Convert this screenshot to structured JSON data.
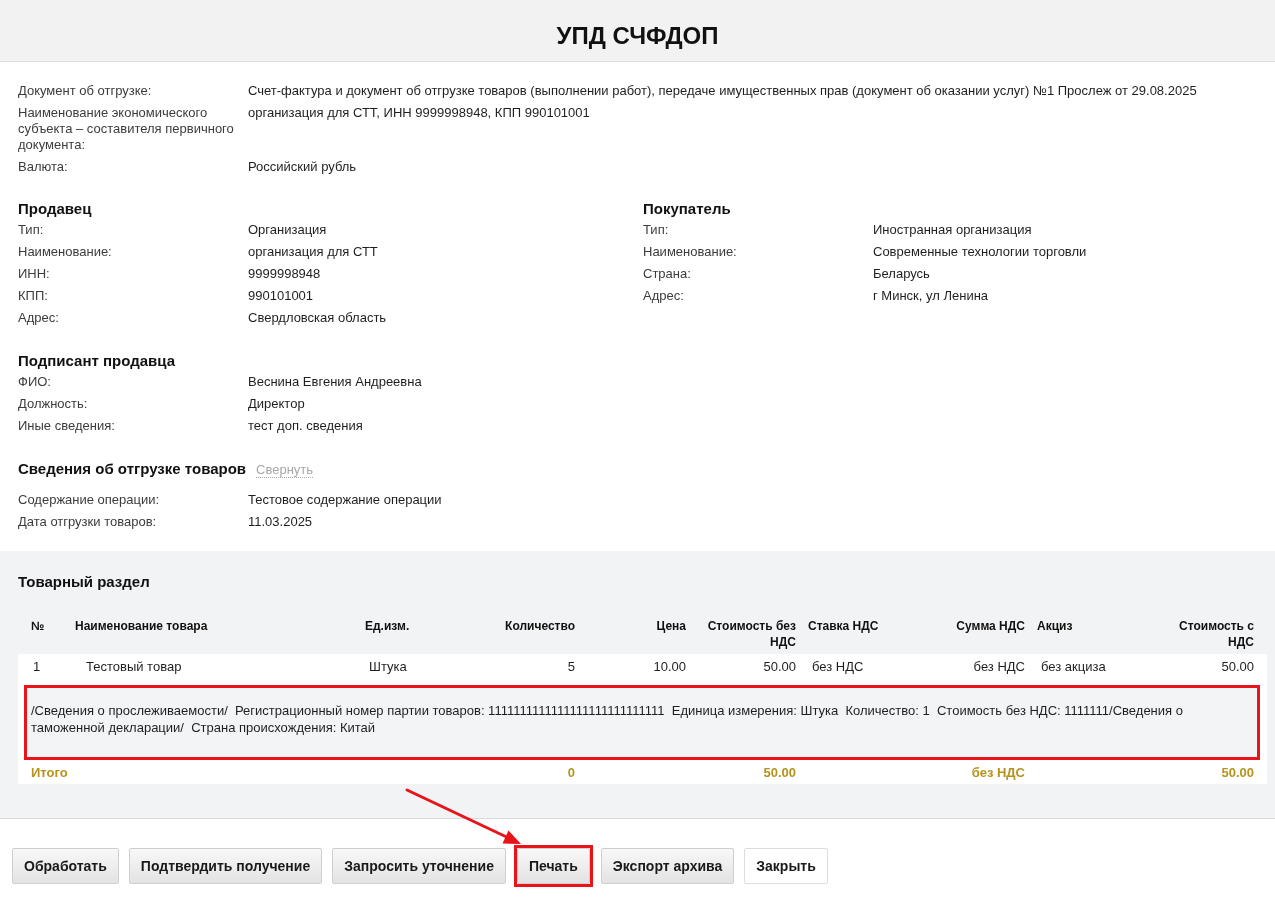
{
  "window": {
    "title": "УПД СЧФДОП"
  },
  "document_fields": [
    {
      "label": "Документ об отгрузке:",
      "value": "Счет-фактура и документ об отгрузке товаров (выполнении работ), передаче имущественных прав (документ об оказании услуг) №1 Прослеж от 29.08.2025"
    },
    {
      "label": "Наименование экономического субъекта – составителя первичного документа:",
      "value": "организация для СТТ, ИНН 9999998948, КПП 990101001"
    },
    {
      "label": "Валюта:",
      "value": "Российский рубль"
    }
  ],
  "seller": {
    "title": "Продавец",
    "fields": [
      {
        "label": "Тип:",
        "value": "Организация"
      },
      {
        "label": "Наименование:",
        "value": "организация для СТТ"
      },
      {
        "label": "ИНН:",
        "value": "9999998948"
      },
      {
        "label": "КПП:",
        "value": "990101001"
      },
      {
        "label": "Адрес:",
        "value": "Свердловская область"
      }
    ]
  },
  "buyer": {
    "title": "Покупатель",
    "fields": [
      {
        "label": "Тип:",
        "value": "Иностранная организация"
      },
      {
        "label": "Наименование:",
        "value": "Современные технологии торговли"
      },
      {
        "label": "Страна:",
        "value": "Беларусь"
      },
      {
        "label": "Адрес:",
        "value": "г Минск, ул Ленина"
      }
    ]
  },
  "seller_signer": {
    "title": "Подписант продавца",
    "fields": [
      {
        "label": "ФИО:",
        "value": "Веснина Евгения Андреевна"
      },
      {
        "label": "Должность:",
        "value": "Директор"
      },
      {
        "label": "Иные сведения:",
        "value": "тест доп. сведения"
      }
    ]
  },
  "shipment": {
    "title": "Сведения об отгрузке товаров",
    "toggle": "Свернуть",
    "fields": [
      {
        "label": "Содержание операции:",
        "value": "Тестовое содержание операции"
      },
      {
        "label": "Дата отгрузки товаров:",
        "value": "11.03.2025"
      }
    ]
  },
  "goods": {
    "title": "Товарный раздел",
    "columns": [
      "№",
      "Наименование товара",
      "Ед.изм.",
      "Количество",
      "Цена",
      "Стоимость без НДС",
      "Ставка НДС",
      "Сумма НДС",
      "Акциз",
      "Стоимость с НДС"
    ],
    "rows": [
      {
        "number": "1",
        "name": "Тестовый товар",
        "unit": "Штука",
        "quantity": "5",
        "price": "10.00",
        "amount_without_vat": "50.00",
        "vat_rate": "без НДС",
        "vat_amount": "без НДС",
        "excise": "без акциза",
        "amount_with_vat": "50.00",
        "details": "/Сведения о прослеживаемости/  Регистрационный номер партии товаров: 1111111111111111111111111111  Единица измерения: Штука  Количество: 1  Стоимость без НДС: 1111111/Сведения о таможенной декларации/  Страна происхождения: Китай",
        "highlighted": true
      }
    ],
    "total": {
      "label": "Итого",
      "quantity": "0",
      "amount_without_vat": "50.00",
      "vat_amount": "без НДС",
      "amount_with_vat": "50.00"
    }
  },
  "buttons": [
    {
      "label": "Обработать",
      "kind": "default",
      "highlighted": false
    },
    {
      "label": "Подтвердить получение",
      "kind": "default",
      "highlighted": false
    },
    {
      "label": "Запросить уточнение",
      "kind": "default",
      "highlighted": false
    },
    {
      "label": "Печать",
      "kind": "default",
      "highlighted": true
    },
    {
      "label": "Экспорт архива",
      "kind": "default",
      "highlighted": false
    },
    {
      "label": "Закрыть",
      "kind": "plain",
      "highlighted": false
    }
  ]
}
